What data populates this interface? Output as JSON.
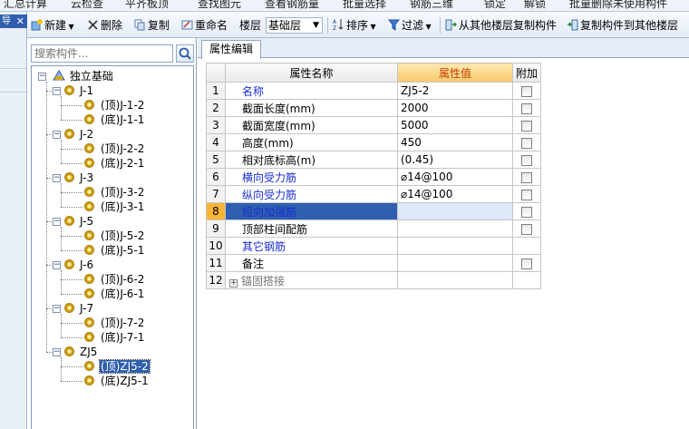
{
  "top_strip": {
    "items": [
      "汇总计算",
      "云检查",
      "平齐板顶",
      "查找图元",
      "查看钢筋量",
      "批量选择",
      "钢筋三维",
      "锁定",
      "解锁",
      "批量删除未使用构件"
    ]
  },
  "left_strip": {
    "tab_label": "导",
    "close_icon": "close-icon"
  },
  "toolbar": {
    "new_label": "新建",
    "delete_label": "删除",
    "copy_label": "复制",
    "rename_label": "重命名",
    "floor_label": "楼层",
    "floor_value": "基础层",
    "sort_label": "排序",
    "filter_label": "过滤",
    "copy_from_label": "从其他楼层复制构件",
    "copy_to_label": "复制构件到其他楼层"
  },
  "search": {
    "placeholder": "搜索构件..."
  },
  "tree": {
    "root": "独立基础",
    "groups": [
      {
        "name": "J-1",
        "children": [
          "(顶)J-1-2",
          "(底)J-1-1"
        ]
      },
      {
        "name": "J-2",
        "children": [
          "(顶)J-2-2",
          "(底)J-2-1"
        ]
      },
      {
        "name": "J-3",
        "children": [
          "(顶)J-3-2",
          "(底)J-3-1"
        ]
      },
      {
        "name": "J-5",
        "children": [
          "(顶)J-5-2",
          "(底)J-5-1"
        ]
      },
      {
        "name": "J-6",
        "children": [
          "(顶)J-6-2",
          "(底)J-6-1"
        ]
      },
      {
        "name": "J-7",
        "children": [
          "(顶)J-7-2",
          "(底)J-7-1"
        ]
      },
      {
        "name": "ZJ5",
        "children": [
          "(顶)ZJ5-2",
          "(底)ZJ5-1"
        ]
      }
    ],
    "selected": "(顶)ZJ5-2"
  },
  "panel": {
    "tab": "属性编辑"
  },
  "grid": {
    "headers": {
      "name": "属性名称",
      "value": "属性值",
      "extra": "附加"
    },
    "rows": [
      {
        "no": "1",
        "name": "名称",
        "value": "ZJ5-2"
      },
      {
        "no": "2",
        "name": "截面长度(mm)",
        "value": "2000"
      },
      {
        "no": "3",
        "name": "截面宽度(mm)",
        "value": "5000"
      },
      {
        "no": "4",
        "name": "高度(mm)",
        "value": "450"
      },
      {
        "no": "5",
        "name": "相对底标高(m)",
        "value": "(0.45)"
      },
      {
        "no": "6",
        "name": "横向受力筋",
        "value": "⌀14@100"
      },
      {
        "no": "7",
        "name": "纵向受力筋",
        "value": "⌀14@100"
      },
      {
        "no": "8",
        "name": "短向加强筋",
        "value": ""
      },
      {
        "no": "9",
        "name": "顶部柱间配筋",
        "value": ""
      },
      {
        "no": "10",
        "name": "其它钢筋",
        "value": ""
      },
      {
        "no": "11",
        "name": "备注",
        "value": ""
      },
      {
        "no": "12",
        "name": "锚固搭接",
        "value": ""
      }
    ]
  }
}
